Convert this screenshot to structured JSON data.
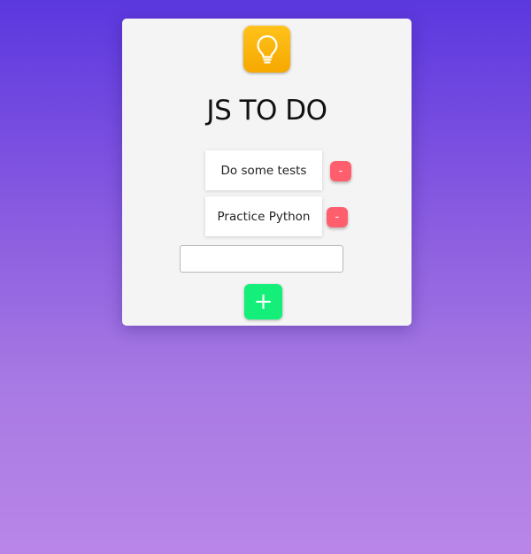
{
  "app": {
    "title": "JS TO DO",
    "logo_icon": "lightbulb-icon"
  },
  "todos": [
    {
      "text": "Do some tests",
      "remove_label": "-"
    },
    {
      "text": "Practice Python",
      "remove_label": "-"
    }
  ],
  "new_todo": {
    "value": "",
    "placeholder": ""
  },
  "add_button": {
    "label": "+"
  },
  "colors": {
    "background_top": "#5b37df",
    "background_bottom": "#b986e8",
    "card": "#f4f4f4",
    "logo": "#ffc21a",
    "remove": "#ff5f6d",
    "add": "#14ef7a"
  }
}
